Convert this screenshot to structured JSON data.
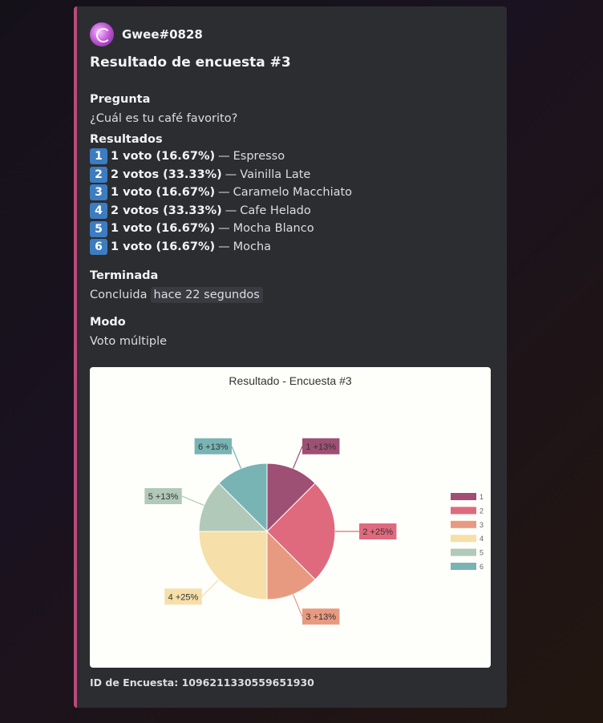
{
  "embed": {
    "accent_color": "#b94a7c",
    "author": {
      "name": "Gwee#0828",
      "avatar_icon": "avatar-icon"
    },
    "title": "Resultado de encuesta #3",
    "fields": {
      "question": {
        "name": "Pregunta",
        "value": "¿Cuál es tu café favorito?"
      },
      "results": {
        "name": "Resultados",
        "items": [
          {
            "num": "1",
            "votes": "1 voto (16.67%)",
            "option": "Espresso"
          },
          {
            "num": "2",
            "votes": "2 votos (33.33%)",
            "option": "Vainilla Late"
          },
          {
            "num": "3",
            "votes": "1 voto (16.67%)",
            "option": "Caramelo Macchiato"
          },
          {
            "num": "4",
            "votes": "2 votos (33.33%)",
            "option": "Cafe Helado"
          },
          {
            "num": "5",
            "votes": "1 voto (16.67%)",
            "option": "Mocha Blanco"
          },
          {
            "num": "6",
            "votes": "1 voto (16.67%)",
            "option": "Mocha"
          }
        ],
        "separator": "—"
      },
      "ended": {
        "name": "Terminada",
        "prefix": "Concluida",
        "timestamp": "hace 22 segundos"
      },
      "mode": {
        "name": "Modo",
        "value": "Voto múltiple"
      }
    },
    "footer": "ID de Encuesta: 1096211330559651930"
  },
  "chart_data": {
    "type": "pie",
    "title": "Resultado - Encuesta #3",
    "categories": [
      "1",
      "2",
      "3",
      "4",
      "5",
      "6"
    ],
    "values": [
      1,
      2,
      1,
      2,
      1,
      1
    ],
    "labels": [
      "1 +13%",
      "2 +25%",
      "3 +13%",
      "4 +25%",
      "5 +13%",
      "6 +13%"
    ],
    "colors": [
      "#9e4f74",
      "#e06a7d",
      "#e89a80",
      "#f6dfa8",
      "#b1c9b9",
      "#79b4b5"
    ],
    "legend": "right"
  }
}
